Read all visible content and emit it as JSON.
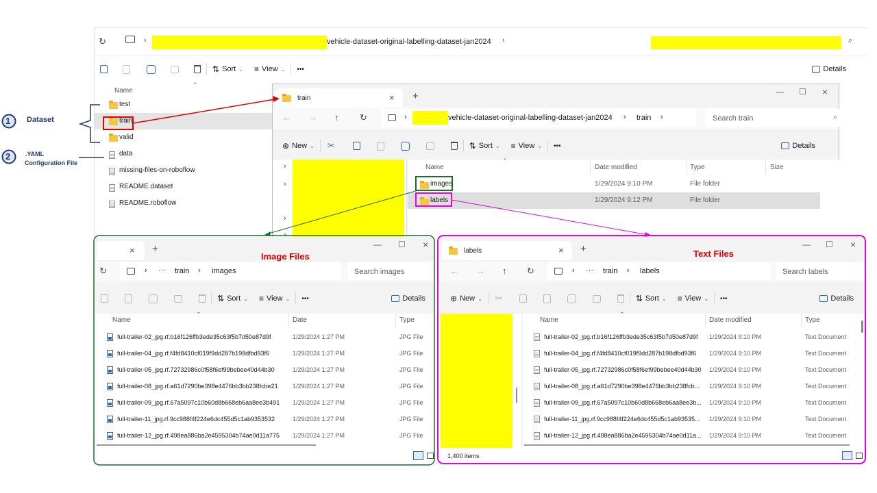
{
  "annotations": {
    "badge1": "1",
    "badge1_label": "Dataset",
    "badge2": "2",
    "badge2_label_line1": ".YAML",
    "badge2_label_line2": "Configuration File",
    "image_files": "Image Files",
    "text_files": "Text Files",
    "colors": {
      "red": "#e00000",
      "green": "#1e6b2e",
      "magenta": "#e600e6",
      "navy": "#1f3b6e"
    }
  },
  "main": {
    "address_suffix": "vehicle-dataset-original-labelling-dataset-jan2024",
    "toolbar": {
      "sort": "Sort",
      "view": "View",
      "more": "•••",
      "details": "Details"
    },
    "column_name": "Name",
    "items": [
      {
        "name": "test",
        "icon": "folder-icon"
      },
      {
        "name": "train",
        "icon": "folder-icon"
      },
      {
        "name": "valid",
        "icon": "folder-icon"
      },
      {
        "name": "data",
        "icon": "file-icon"
      },
      {
        "name": "missing-files-on-roboflow",
        "icon": "file-icon"
      },
      {
        "name": "README.dataset",
        "icon": "file-icon"
      },
      {
        "name": "README.roboflow",
        "icon": "file-icon"
      }
    ]
  },
  "train": {
    "tab": "train",
    "crumb_suffix": "vehicle-dataset-original-labelling-dataset-jan2024",
    "crumb_current": "train",
    "search_placeholder": "Search train",
    "toolbar": {
      "new": "New",
      "sort": "Sort",
      "view": "View",
      "more": "•••",
      "details": "Details"
    },
    "columns": {
      "name": "Name",
      "date": "Date modified",
      "type": "Type",
      "size": "Size"
    },
    "items": [
      {
        "name": "images",
        "date": "1/29/2024 9:10 PM",
        "type": "File folder"
      },
      {
        "name": "labels",
        "date": "1/29/2024 9:12 PM",
        "type": "File folder"
      }
    ]
  },
  "images": {
    "crumb_more": "···",
    "crumb_1": "train",
    "crumb_2": "images",
    "search_placeholder": "Search images",
    "toolbar": {
      "sort": "Sort",
      "view": "View",
      "more": "•••",
      "details": "Details"
    },
    "columns": {
      "name": "Name",
      "date": "Date",
      "type": "Type"
    },
    "rows": [
      {
        "name": "full-trailer-02_jpg.rf.b16f126ffb3ede35c63f5b7d50e87d9f",
        "date": "1/29/2024 1:27 PM",
        "type": "JPG File"
      },
      {
        "name": "full-trailer-04_jpg.rf.f4fd8410cf019f9dd287b198dfbd93f6",
        "date": "1/29/2024 1:27 PM",
        "type": "JPG File"
      },
      {
        "name": "full-trailer-05_jpg.rf.72732986c0f58f6ef99bebee40d44b30",
        "date": "1/29/2024 1:27 PM",
        "type": "JPG File"
      },
      {
        "name": "full-trailer-08_jpg.rf.a61d7290be398e4476bb3bb238fcbe21",
        "date": "1/29/2024 1:27 PM",
        "type": "JPG File"
      },
      {
        "name": "full-trailer-09_jpg.rf.67a5097c10b60d8b668eb6aa8ee3b491",
        "date": "1/29/2024 1:27 PM",
        "type": "JPG File"
      },
      {
        "name": "full-trailer-11_jpg.rf.9cc988f4f224e6dc455d5c1ab9353532",
        "date": "1/29/2024 1:27 PM",
        "type": "JPG File"
      },
      {
        "name": "full-trailer-12_jpg.rf.498ea886ba2e4595304b74ae0d11a775",
        "date": "1/29/2024 1:27 PM",
        "type": "JPG File"
      }
    ]
  },
  "labels": {
    "tab": "labels",
    "crumb_more": "···",
    "crumb_1": "train",
    "crumb_2": "labels",
    "search_placeholder": "Search labels",
    "toolbar": {
      "new": "New",
      "sort": "Sort",
      "view": "View",
      "more": "•••",
      "details": "Details"
    },
    "columns": {
      "name": "Name",
      "date": "Date modified",
      "type": "Type"
    },
    "rows": [
      {
        "name": "full-trailer-02_jpg.rf.b16f126ffb3ede35c63f5b7d50e87d9f",
        "date": "1/29/2024 9:10 PM",
        "type": "Text Document"
      },
      {
        "name": "full-trailer-04_jpg.rf.f4fd8410cf019f9dd287b198dfbd93f6",
        "date": "1/29/2024 9:10 PM",
        "type": "Text Document"
      },
      {
        "name": "full-trailer-05_jpg.rf.72732986c0f58f6ef99bebee40d44b30",
        "date": "1/29/2024 9:10 PM",
        "type": "Text Document"
      },
      {
        "name": "full-trailer-08_jpg.rf.a61d7290be398e4476bb3bb238fcb...",
        "date": "1/29/2024 9:10 PM",
        "type": "Text Document"
      },
      {
        "name": "full-trailer-09_jpg.rf.67a5097c10b60d8b668eb6aa8ee3b...",
        "date": "1/29/2024 9:10 PM",
        "type": "Text Document"
      },
      {
        "name": "full-trailer-11_jpg.rf.9cc988f4f224e6dc455d5c1ab93535...",
        "date": "1/29/2024 9:10 PM",
        "type": "Text Document"
      },
      {
        "name": "full-trailer-12_jpg.rf.498ea886ba2e4595304b74ae0d11a...",
        "date": "1/29/2024 9:10 PM",
        "type": "Text Document"
      }
    ],
    "status": "1,400 items"
  }
}
